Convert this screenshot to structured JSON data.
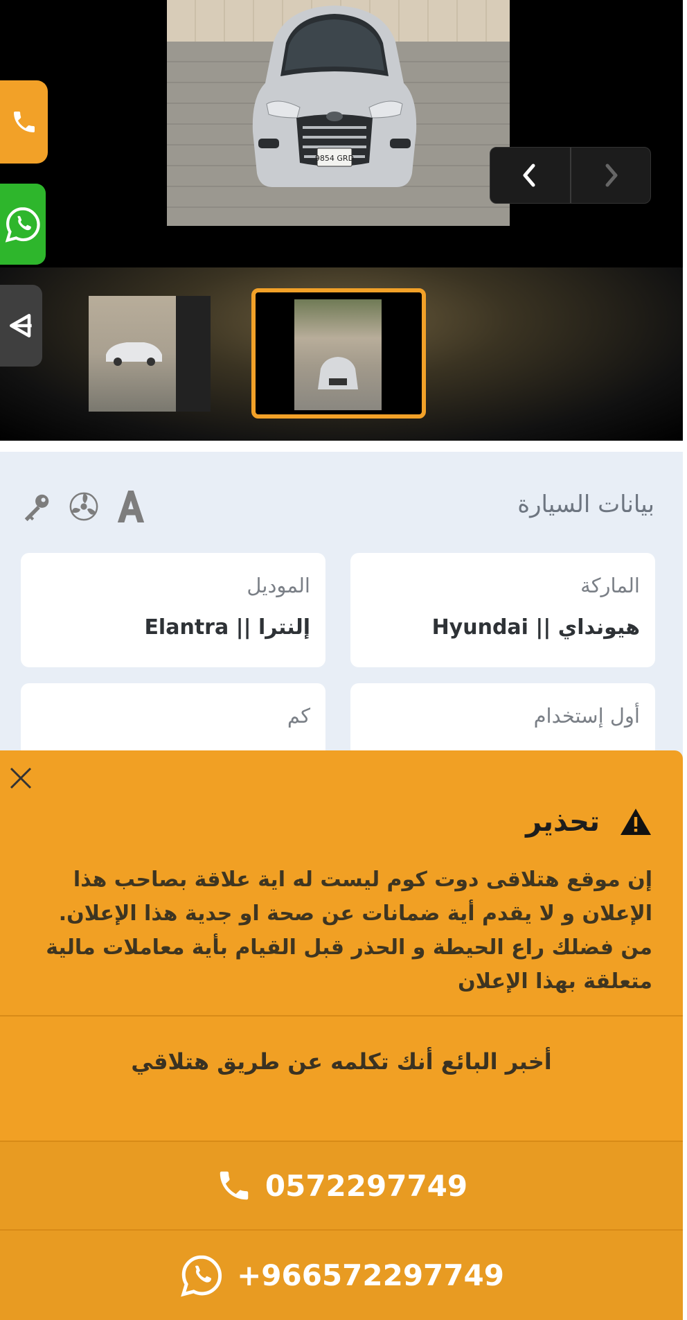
{
  "gallery": {
    "photo_alt": "Hyundai Elantra silver",
    "thumbnails": [
      "thumbnail-1",
      "thumbnail-2"
    ],
    "selected_thumbnail": 2
  },
  "car_data": {
    "section_title": "بيانات السيارة",
    "fields": {
      "brand": {
        "label": "الماركة",
        "value": "هيونداي || Hyundai"
      },
      "model": {
        "label": "الموديل",
        "value": "إلنترا || Elantra"
      },
      "first_use": {
        "label": "أول إستخدام",
        "value": ""
      },
      "km": {
        "label": "كم",
        "value": ""
      }
    }
  },
  "warning": {
    "title": "تحذير",
    "body": "إن موقع هتلاقى دوت كوم ليست له اية علاقة بصاحب هذا الإعلان و لا يقدم أية ضمانات عن صحة او جدية هذا الإعلان. من فضلك راع الحيطة و الحذر قبل القيام بأية معاملات مالية متعلقة بهذا الإعلان",
    "tell_seller": "أخبر البائع أنك تكلمه عن طريق هتلاقي",
    "phone": "0572297749",
    "whatsapp": "+966572297749"
  },
  "colors": {
    "accent": "#f2a128",
    "whatsapp": "#2eb62c",
    "modal": "#f1a024",
    "details_bg": "#e8eef6"
  },
  "icons": {
    "side": [
      "phone-icon",
      "whatsapp-icon",
      "share-icon"
    ],
    "features": [
      "key-icon",
      "fan-icon",
      "font-a-icon"
    ],
    "warning": "warning-triangle-icon",
    "close": "close-icon"
  }
}
